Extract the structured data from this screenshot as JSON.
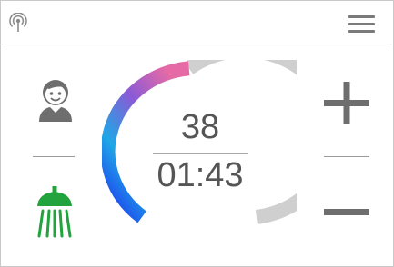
{
  "header": {
    "icons": [
      "signal-icon",
      "menu-icon"
    ]
  },
  "left_panel": {
    "icons": [
      "user-icon",
      "shower-icon"
    ],
    "shower_color": "#23a33d"
  },
  "dial": {
    "temperature": "38",
    "timer": "01:43",
    "gradient_colors": [
      "#1d2ff0",
      "#1fa7e6",
      "#8a5ad6",
      "#e56aa6"
    ],
    "track_color": "#cfcfcf"
  },
  "right_panel": {
    "icons": [
      "plus-icon",
      "minus-icon"
    ]
  }
}
